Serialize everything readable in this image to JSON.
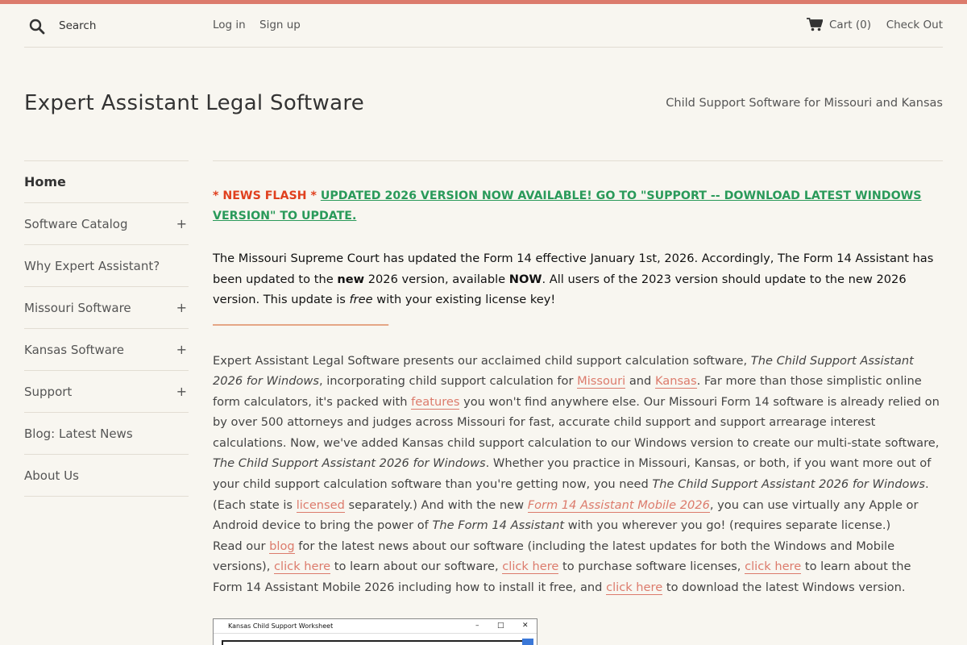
{
  "header": {
    "search_placeholder": "Search",
    "login": "Log in",
    "signup": "Sign up",
    "cart": "Cart (0)",
    "checkout": "Check Out"
  },
  "site": {
    "title": "Expert Assistant Legal Software",
    "tagline": "Child Support Software for Missouri and Kansas"
  },
  "sidebar": {
    "items": [
      {
        "label": "Home",
        "expandable": false
      },
      {
        "label": "Software Catalog",
        "expandable": true
      },
      {
        "label": "Why Expert Assistant?",
        "expandable": false
      },
      {
        "label": "Missouri Software",
        "expandable": true
      },
      {
        "label": "Kansas Software",
        "expandable": true
      },
      {
        "label": "Support",
        "expandable": true
      },
      {
        "label": "Blog: Latest News",
        "expandable": false
      },
      {
        "label": "About Us",
        "expandable": false
      }
    ],
    "expand_symbol": "+"
  },
  "main": {
    "news_flash": "* NEWS FLASH * ",
    "news_link": "UPDATED 2026 VERSION NOW AVAILABLE! GO TO \"SUPPORT -- DOWNLOAD LATEST WINDOWS VERSION\" TO UPDATE.",
    "update_notice": {
      "t1": "The Missouri Supreme Court has updated the Form 14 effective January 1st, 2026.  Accordingly, The Form 14 Assistant has been updated to the ",
      "b1": "new",
      "t2": " 2026 version, available ",
      "b2": "NOW",
      "t3": ".  All users of the 2023 version should update to the new 2026 version. This update is ",
      "i1": "free",
      "t4": " with your existing license key!"
    },
    "separator": "________________________________",
    "intro": {
      "t1": "Expert Assistant Legal Software presents our acclaimed child support calculation software, ",
      "i1": "The Child Support Assistant 2026 for Windows",
      "t2": ", incorporating child support calculation for ",
      "l_missouri": "Missouri",
      "t3": " and ",
      "l_kansas": "Kansas",
      "t4": ". Far more than those simplistic online form calculators, it's packed with ",
      "l_features": "features",
      "t5": " you won't find anywhere else. Our Missouri Form 14 software is already relied on by over 500 attorneys and judges across Missouri for fast, accurate child support and support arrearage interest calculations. Now, we've added Kansas child support calculation to our Windows version to create our multi-state software, ",
      "i2": "The Child Support Assistant 2026 for Windows",
      "t6": ". Whether you practice in Missouri, Kansas, or both, if you want more out of your child support calculation software than you're getting now, you need ",
      "i3": "The Child Support Assistant 2026 for Windows",
      "t7": ". (Each state is ",
      "l_licensed": "licensed",
      "t8": " separately.)  And with the new ",
      "l_mobile": "Form 14 Assistant Mobile 2026",
      "t9": ", you can use virtually any Apple or Android device to bring the power of ",
      "i4": "The Form 14 Assistant",
      "t10": " with you wherever you go! (requires separate license.)"
    },
    "read": {
      "t1": "Read our ",
      "l_blog": "blog",
      "t2": " for the latest news about our software (including the latest updates for both the Windows and Mobile versions), ",
      "l_c1": "click here",
      "t3": " to learn about our software, ",
      "l_c2": "click here",
      "t4": " to purchase software licenses, ",
      "l_c3": "click here",
      "t5": " to learn about the Form 14 Assistant Mobile 2026 including how to install it free, and ",
      "l_c4": "click here",
      "t6": " to download the latest Windows version."
    },
    "screenshot": {
      "title": "Kansas Child Support Worksheet",
      "minimize": "–",
      "maximize": "□",
      "close": "✕"
    }
  },
  "colors": {
    "accent": "#dc7b6c",
    "news_red": "#e0401e",
    "news_green": "#2a9a5a",
    "background": "#f8f6f0"
  },
  "icons": [
    "search-icon",
    "cart-icon"
  ]
}
